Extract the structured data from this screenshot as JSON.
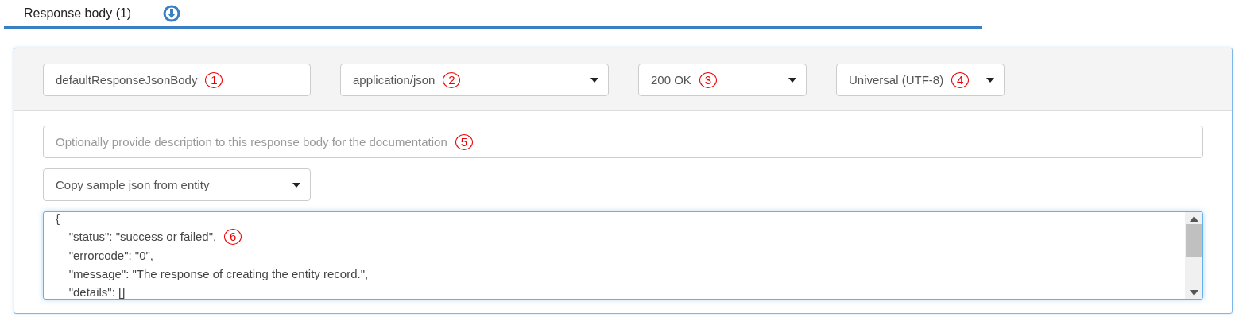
{
  "tab": {
    "label": "Response body (1)",
    "selected": true
  },
  "header_fields": [
    {
      "kind": "input",
      "value": "defaultResponseJsonBody",
      "callout": "1"
    },
    {
      "kind": "select",
      "value": "application/json",
      "callout": "2"
    },
    {
      "kind": "select",
      "value": "200 OK",
      "callout": "3"
    },
    {
      "kind": "select",
      "value": "Universal (UTF-8)",
      "callout": "4"
    }
  ],
  "description": {
    "placeholder": "Optionally provide description to this response body for the documentation",
    "callout": "5"
  },
  "copy_select": {
    "value": "Copy sample json from entity"
  },
  "editor": {
    "callout": "6",
    "lines": [
      "{",
      "    \"status\": \"success or failed\",",
      "    \"errorcode\": \"0\",",
      "    \"message\": \"The response of creating the entity record.\",",
      "    \"details\": []"
    ]
  }
}
